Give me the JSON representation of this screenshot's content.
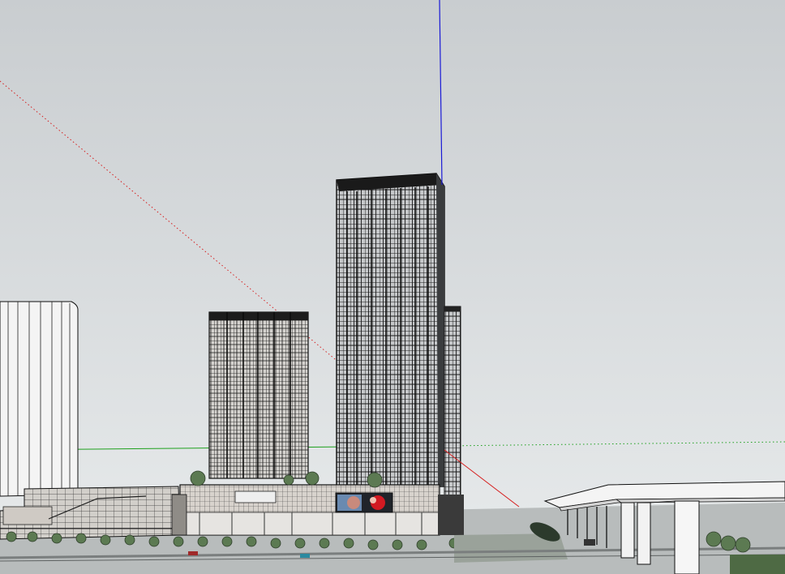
{
  "viewport": {
    "colors": {
      "sky_top": "#c9cdd0",
      "sky_bottom": "#e8ebec",
      "axis_red": "#d62020",
      "axis_green": "#1ea01e",
      "axis_blue": "#1a1ad6",
      "building_edge": "#111111",
      "facade_light": "#d9d6d2",
      "white_mass": "#f4f4f4",
      "ground": "#b8bcbc",
      "tree": "#5c7a52",
      "billboard_red": "#d21a22",
      "billboard_face": "#c98a7c"
    }
  }
}
